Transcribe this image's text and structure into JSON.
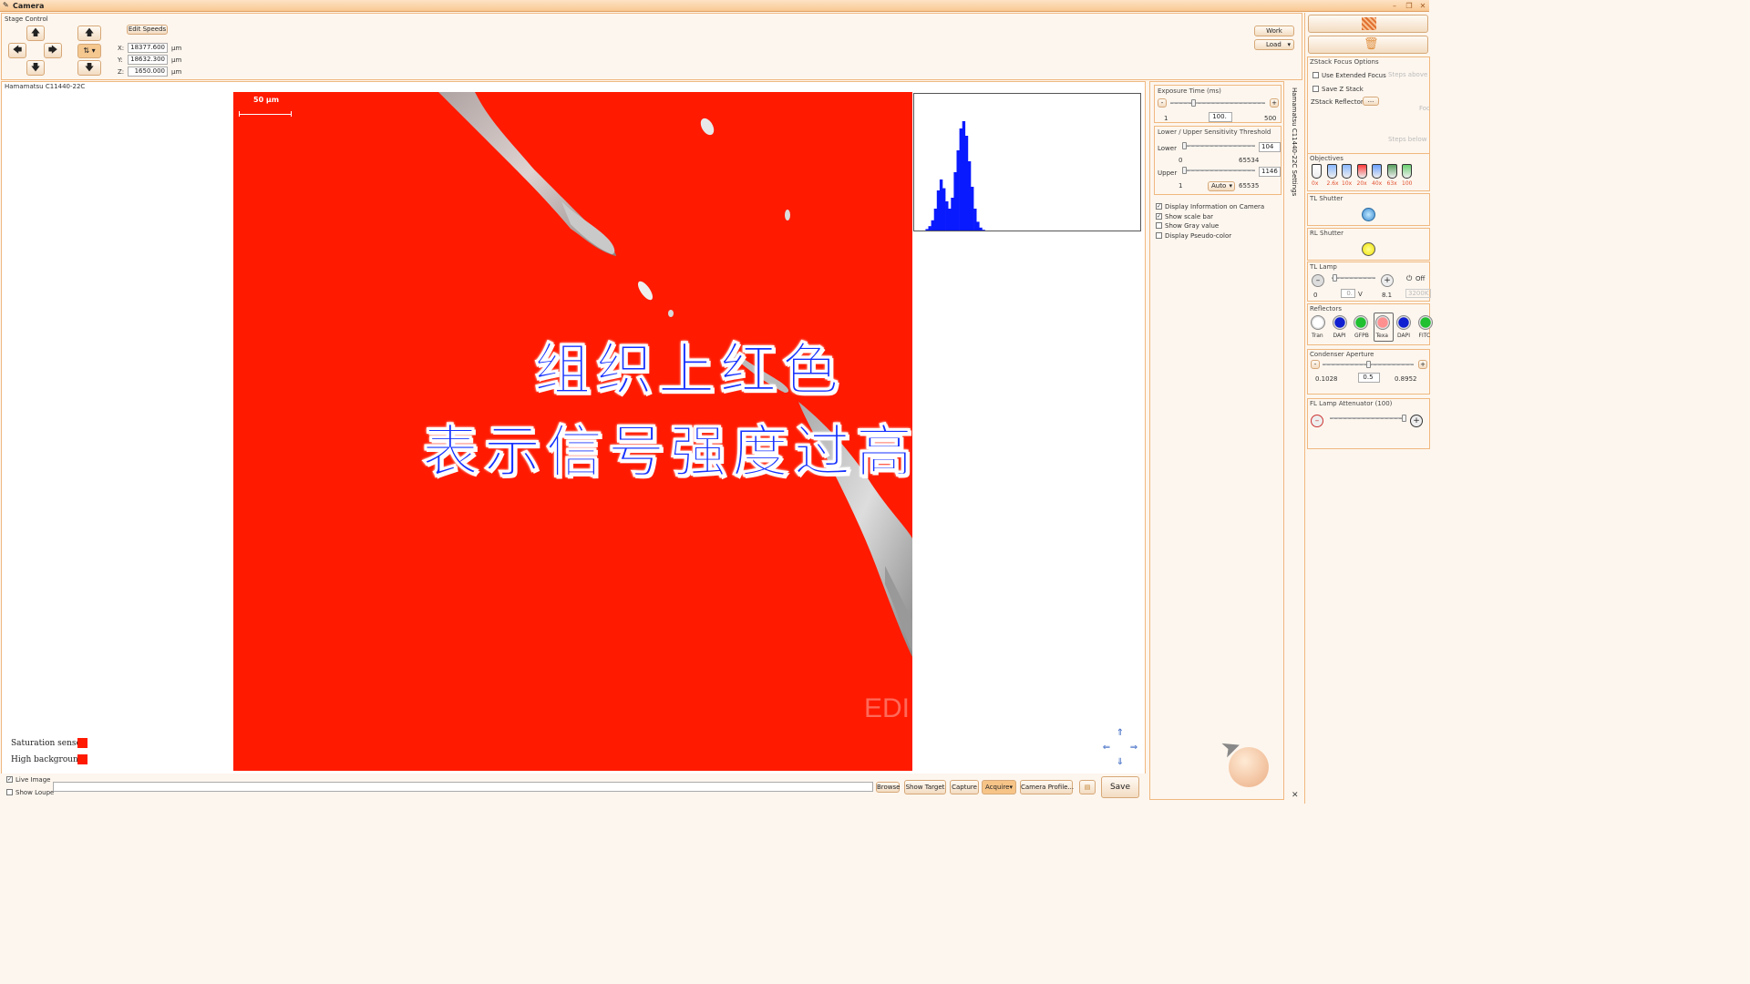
{
  "window": {
    "title": "Camera"
  },
  "stage": {
    "title": "Stage Control",
    "edit_speeds": "Edit Speeds",
    "x_label": "X:",
    "x_value": "18377.600",
    "y_label": "Y:",
    "y_value": "18632.300",
    "z_label": "Z:",
    "z_value": "1650.000",
    "unit": "µm",
    "work": "Work",
    "load": "Load"
  },
  "camera": {
    "name": "Hamamatsu C11440-22C",
    "scale_bar": "50 µm",
    "watermark": "EDI",
    "overlay_line1": "组织上红色",
    "overlay_line2": "表示信号强度过高",
    "saturation_label": "Saturation sensor:",
    "background_label": "High background:"
  },
  "bottom": {
    "live_image": "Live Image",
    "show_loupe": "Show Loupe",
    "browse": "Browse",
    "show_target": "Show Target",
    "capture": "Capture",
    "acquire": "Acquire",
    "camera_profile": "Camera Profile...",
    "save": "Save"
  },
  "settings": {
    "tab_label": "Hamamatsu C11440-22C Settings",
    "exposure_title": "Exposure Time (ms)",
    "exposure_min": "1",
    "exposure_value": "100.",
    "exposure_max": "500",
    "threshold_title": "Lower / Upper Sensitivity Threshold",
    "lower_label": "Lower",
    "lower_value": "104",
    "lower_min": "0",
    "lower_max": "65534",
    "upper_label": "Upper",
    "upper_value": "1146",
    "upper_min": "1",
    "upper_mode": "Auto",
    "upper_max": "65535",
    "opt_display_info": "Display Information on Camera",
    "opt_scale_bar": "Show scale bar",
    "opt_gray": "Show Gray value",
    "opt_pseudo": "Display Pseudo-color"
  },
  "right": {
    "zstack_title": "ZStack Focus Options",
    "use_extended": "Use Extended Focus",
    "steps_above": "Steps above",
    "save_zstack": "Save Z Stack",
    "zstack_reflectors": "ZStack Reflectors",
    "ellipsis": "...",
    "focus": "Foc",
    "steps_below": "Steps below",
    "objectives_title": "Objectives",
    "objectives": [
      "0x",
      "2.6x",
      "10x",
      "20x",
      "40x",
      "63x",
      "100"
    ],
    "tl_shutter": "TL Shutter",
    "rl_shutter": "RL Shutter",
    "tl_lamp": "TL Lamp",
    "tl_min": "0",
    "tl_value": "0.",
    "tl_unit": "V",
    "tl_max": "8.1",
    "tl_off": "Off",
    "tl_temp": "3200K",
    "reflectors_title": "Reflectors",
    "reflectors": [
      "Tran",
      "DAPI",
      "GFPB",
      "Texa",
      "DAPI",
      "FITC"
    ],
    "condenser_title": "Condenser Aperture",
    "cond_min": "0.1028",
    "cond_value": "0.5",
    "cond_max": "0.8952",
    "fl_title": "FL Lamp Attenuator (100)"
  },
  "colors": {
    "saturation": "#ff1a00",
    "histogram": "#0a1aff",
    "overlay_text": "#1530ff",
    "accent": "#f0b880"
  },
  "histogram": {
    "bins": [
      0,
      0,
      0,
      0,
      2,
      6,
      14,
      30,
      55,
      70,
      58,
      40,
      30,
      45,
      80,
      110,
      140,
      150,
      130,
      95,
      60,
      30,
      12,
      4,
      1,
      0,
      0,
      0,
      0,
      0,
      0,
      0,
      0,
      0,
      0,
      0,
      0,
      0,
      0,
      0,
      0,
      0,
      0,
      0,
      0,
      0,
      0,
      0,
      0,
      0,
      0,
      0,
      0,
      0,
      0,
      0,
      0,
      0,
      0,
      0,
      0,
      0,
      0,
      0,
      0,
      0,
      0,
      0,
      0,
      0,
      0,
      0,
      0,
      0,
      0,
      0,
      0,
      0,
      0,
      0
    ]
  }
}
